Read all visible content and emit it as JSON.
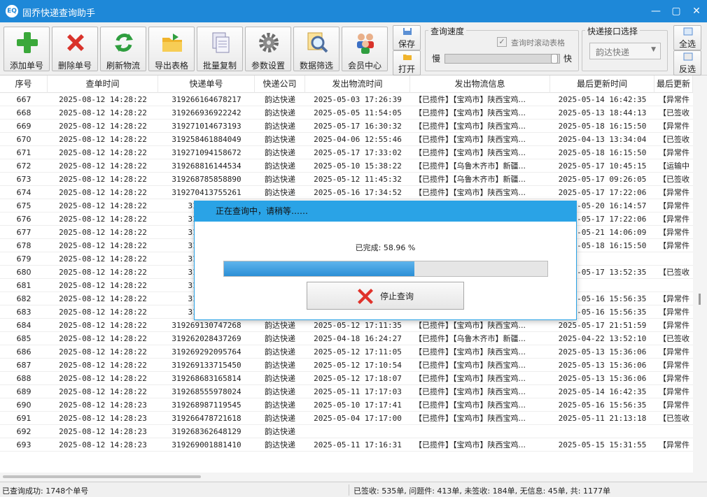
{
  "window": {
    "title": "固乔快递查询助手",
    "app_icon": "app-logo-icon",
    "minimize": "—",
    "maximize": "▢",
    "close": "✕"
  },
  "toolbar": {
    "buttons": [
      {
        "label": "添加单号",
        "icon": "plus-icon"
      },
      {
        "label": "删除单号",
        "icon": "delete-x-icon"
      },
      {
        "label": "刷新物流",
        "icon": "refresh-icon"
      },
      {
        "label": "导出表格",
        "icon": "export-folder-icon"
      },
      {
        "label": "批量复制",
        "icon": "copy-icon"
      },
      {
        "label": "参数设置",
        "icon": "gear-icon"
      },
      {
        "label": "数据筛选",
        "icon": "magnifier-icon"
      },
      {
        "label": "会员中心",
        "icon": "users-icon"
      }
    ],
    "save_label": "保存",
    "open_label": "打开",
    "speed_group_title": "查询速度",
    "scroll_checkbox_label": "查询时滚动表格",
    "scroll_checkbox_checked": true,
    "slow_label": "慢",
    "fast_label": "快",
    "speed_value_percent": 100,
    "api_group_title": "快递接口选择",
    "api_selected": "韵达快递",
    "select_all_label": "全选",
    "invert_select_label": "反选"
  },
  "grid": {
    "columns": [
      "序号",
      "查单时间",
      "快递单号",
      "快递公司",
      "发出物流时间",
      "发出物流信息",
      "最后更新时间",
      "最后更新"
    ],
    "rows": [
      [
        "667",
        "2025-08-12 14:28:22",
        "319266164678217",
        "韵达快递",
        "2025-05-03 17:26:39",
        "【已揽件】【宝鸡市】陕西宝鸡...",
        "2025-05-14 16:42:35",
        "【异常件"
      ],
      [
        "668",
        "2025-08-12 14:28:22",
        "319266936922242",
        "韵达快递",
        "2025-05-05 11:54:05",
        "【已揽件】【宝鸡市】陕西宝鸡...",
        "2025-05-13 18:44:13",
        "【已签收"
      ],
      [
        "669",
        "2025-08-12 14:28:22",
        "319271014673193",
        "韵达快递",
        "2025-05-17 16:30:32",
        "【已揽件】【宝鸡市】陕西宝鸡...",
        "2025-05-18 16:15:50",
        "【异常件"
      ],
      [
        "670",
        "2025-08-12 14:28:22",
        "319258461884049",
        "韵达快递",
        "2025-04-06 12:55:46",
        "【已揽件】【宝鸡市】陕西宝鸡...",
        "2025-04-13 13:34:04",
        "【已签收"
      ],
      [
        "671",
        "2025-08-12 14:28:22",
        "319271094158672",
        "韵达快递",
        "2025-05-17 17:33:02",
        "【已揽件】【宝鸡市】陕西宝鸡...",
        "2025-05-18 16:15:50",
        "【异常件"
      ],
      [
        "672",
        "2025-08-12 14:28:22",
        "319268816144534",
        "韵达快递",
        "2025-05-10 15:38:22",
        "【已揽件】【乌鲁木齐市】新疆...",
        "2025-05-17 10:45:15",
        "【运输中"
      ],
      [
        "673",
        "2025-08-12 14:28:22",
        "319268785858890",
        "韵达快递",
        "2025-05-12 11:45:32",
        "【已揽件】【乌鲁木齐市】新疆...",
        "2025-05-17 09:26:05",
        "【已签收"
      ],
      [
        "674",
        "2025-08-12 14:28:22",
        "319270413755261",
        "韵达快递",
        "2025-05-16 17:34:52",
        "【已揽件】【宝鸡市】陕西宝鸡...",
        "2025-05-17 17:22:06",
        "【异常件"
      ],
      [
        "675",
        "2025-08-12 14:28:22",
        "31926702",
        "",
        "",
        "",
        "2025-05-20 16:14:57",
        "【异常件"
      ],
      [
        "676",
        "2025-08-12 14:28:22",
        "31927012",
        "",
        "",
        "",
        "2025-05-17 17:22:06",
        "【异常件"
      ],
      [
        "677",
        "2025-08-12 14:28:22",
        "31927009",
        "",
        "",
        "",
        "2025-05-21 14:06:09",
        "【异常件"
      ],
      [
        "678",
        "2025-08-12 14:28:22",
        "31926892",
        "",
        "",
        "",
        "2025-05-18 16:15:50",
        "【异常件"
      ],
      [
        "679",
        "2025-08-12 14:28:22",
        "31926977",
        "",
        "",
        "",
        "",
        ""
      ],
      [
        "680",
        "2025-08-12 14:28:22",
        "31926885",
        "",
        "",
        "",
        "2025-05-17 13:52:35",
        "【已签收"
      ],
      [
        "681",
        "2025-08-12 14:28:22",
        "31927030",
        "",
        "",
        "",
        "",
        ""
      ],
      [
        "682",
        "2025-08-12 14:28:22",
        "31926877",
        "",
        "",
        "",
        "2025-05-16 15:56:35",
        "【异常件"
      ],
      [
        "683",
        "2025-08-12 14:28:22",
        "31926953",
        "",
        "",
        "",
        "2025-05-16 15:56:35",
        "【异常件"
      ],
      [
        "684",
        "2025-08-12 14:28:22",
        "319269130747268",
        "韵达快递",
        "2025-05-12 17:11:35",
        "【已揽件】【宝鸡市】陕西宝鸡...",
        "2025-05-17 21:51:59",
        "【异常件"
      ],
      [
        "685",
        "2025-08-12 14:28:22",
        "319262028437269",
        "韵达快递",
        "2025-04-18 16:24:27",
        "【已揽件】【乌鲁木齐市】新疆...",
        "2025-04-22 13:52:10",
        "【已签收"
      ],
      [
        "686",
        "2025-08-12 14:28:22",
        "319269292095764",
        "韵达快递",
        "2025-05-12 17:11:05",
        "【已揽件】【宝鸡市】陕西宝鸡...",
        "2025-05-13 15:36:06",
        "【异常件"
      ],
      [
        "687",
        "2025-08-12 14:28:22",
        "319269133715450",
        "韵达快递",
        "2025-05-12 17:10:54",
        "【已揽件】【宝鸡市】陕西宝鸡...",
        "2025-05-13 15:36:06",
        "【异常件"
      ],
      [
        "688",
        "2025-08-12 14:28:22",
        "319268683165814",
        "韵达快递",
        "2025-05-12 17:18:07",
        "【已揽件】【宝鸡市】陕西宝鸡...",
        "2025-05-13 15:36:06",
        "【异常件"
      ],
      [
        "689",
        "2025-08-12 14:28:22",
        "319268555978024",
        "韵达快递",
        "2025-05-11 17:17:03",
        "【已揽件】【宝鸡市】陕西宝鸡...",
        "2025-05-14 16:42:35",
        "【异常件"
      ],
      [
        "690",
        "2025-08-12 14:28:23",
        "319268987119545",
        "韵达快递",
        "2025-05-10 17:17:41",
        "【已揽件】【宝鸡市】陕西宝鸡...",
        "2025-05-16 15:56:35",
        "【异常件"
      ],
      [
        "691",
        "2025-08-12 14:28:23",
        "319266478721618",
        "韵达快递",
        "2025-05-04 17:17:00",
        "【已揽件】【宝鸡市】陕西宝鸡...",
        "2025-05-11 21:13:18",
        "【已签收"
      ],
      [
        "692",
        "2025-08-12 14:28:23",
        "319268362648129",
        "韵达快递",
        "",
        "",
        "",
        ""
      ],
      [
        "693",
        "2025-08-12 14:28:23",
        "319269001881410",
        "韵达快递",
        "2025-05-11 17:16:31",
        "【已揽件】【宝鸡市】陕西宝鸡...",
        "2025-05-15 15:31:55",
        "【异常件"
      ]
    ]
  },
  "status": {
    "left": "已查询成功: 1748个单号",
    "right": "已签收: 535单, 问题件: 413单, 未签收: 184单, 无信息: 45单, 共: 1177单"
  },
  "dialog": {
    "title": "正在查询中，请稍等……",
    "progress_text": "已完成: 58.96 %",
    "progress_percent": 58.96,
    "stop_label": "停止查询",
    "stop_icon": "red-x-icon"
  },
  "colors": {
    "title_bar": "#1e88d8",
    "dialog_accent": "#2aa3e6",
    "progress_fill": "#3a9de0"
  }
}
